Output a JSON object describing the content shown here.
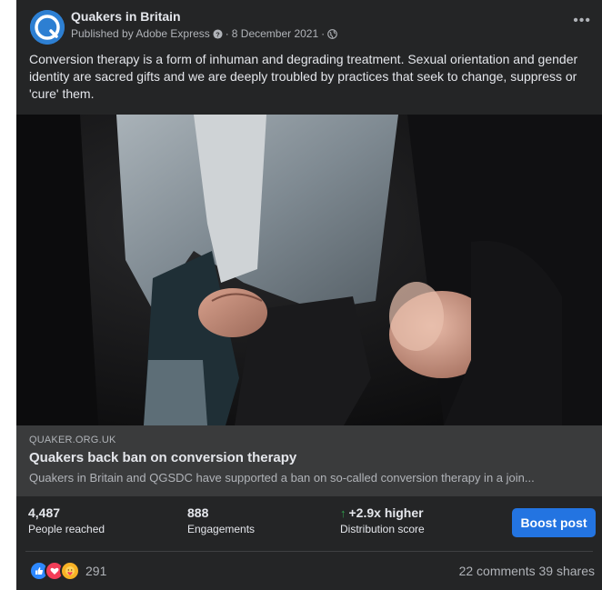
{
  "post": {
    "page_name": "Quakers in Britain",
    "published_by": "Published by Adobe Express",
    "date": "8 December 2021",
    "separator": "·",
    "more_icon": "more-options-icon",
    "text": "Conversion therapy is a form of inhuman and degrading treatment. Sexual orientation and gender identity are sacred gifts and we are deeply troubled by practices that seek to change, suppress or 'cure' them."
  },
  "link_preview": {
    "domain": "QUAKER.ORG.UK",
    "title": "Quakers back ban on conversion therapy",
    "description": "Quakers in Britain and QGSDC have supported a ban on so-called conversion therapy in a join..."
  },
  "stats": {
    "reached_value": "4,487",
    "reached_label": "People reached",
    "engagements_value": "888",
    "engagements_label": "Engagements",
    "distribution_value": "+2.9x higher",
    "distribution_label": "Distribution score",
    "boost_label": "Boost post"
  },
  "reactions": {
    "count": "291",
    "types": [
      "like-icon",
      "love-icon",
      "care-icon"
    ],
    "comments": "22 comments",
    "shares": "39 shares"
  },
  "colors": {
    "card_bg": "#242526",
    "link_bg": "#3a3b3c",
    "accent": "#2374e1",
    "positive": "#31a24c"
  }
}
